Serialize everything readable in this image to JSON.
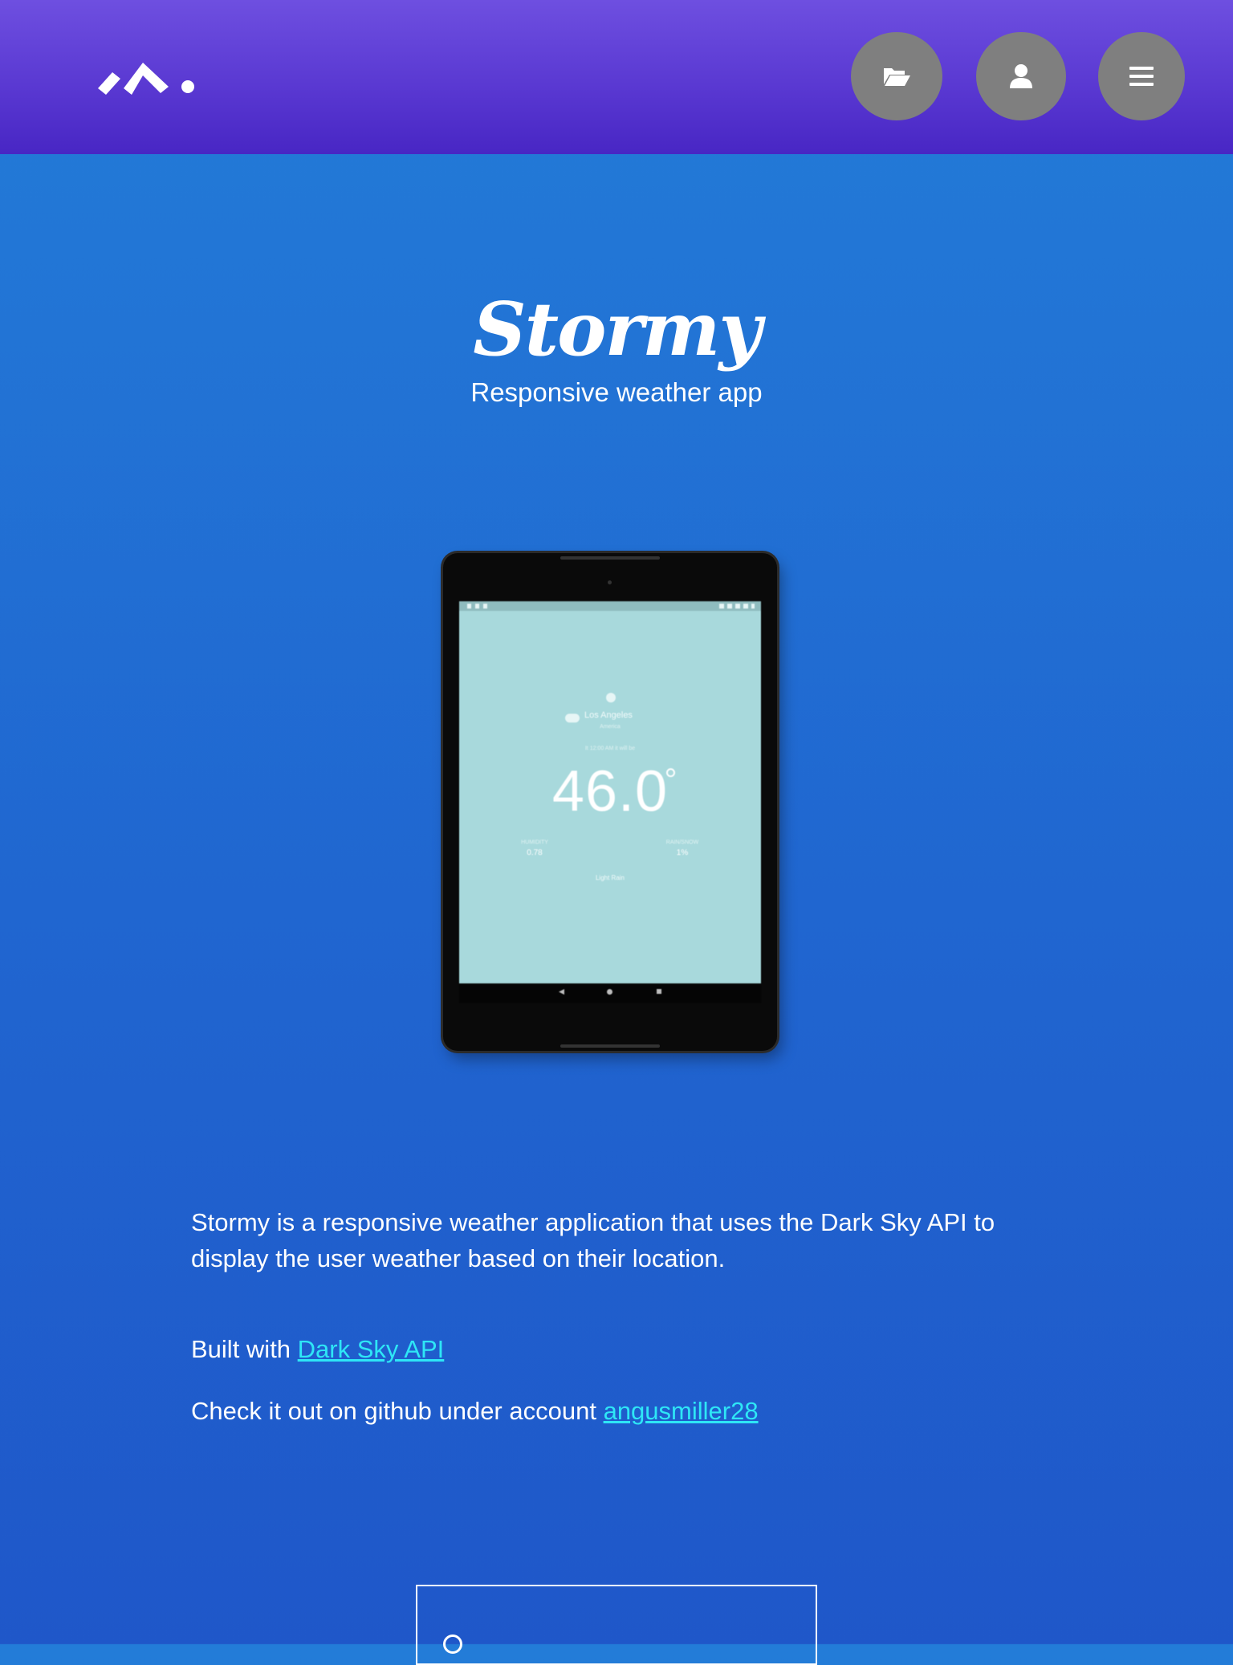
{
  "header": {
    "logo_icon": "brand-logo-icon",
    "buttons": [
      {
        "icon": "folder-open-icon",
        "label": "Projects"
      },
      {
        "icon": "user-icon",
        "label": "Profile"
      },
      {
        "icon": "menu-icon",
        "label": "Menu"
      }
    ],
    "colors": {
      "header_top": "#6e4fe0",
      "header_bottom": "#4826c4",
      "button_bg": "#7f7f7f"
    }
  },
  "hero": {
    "title": "Stormy",
    "subtitle": "Responsive weather app"
  },
  "device_screen": {
    "city": "Los Angeles",
    "region": "America",
    "time": "It 12:00 AM it will be",
    "temperature": "46.0",
    "humidity_label": "HUMIDITY",
    "humidity_value": "0.78",
    "precip_label": "RAIN/SNOW",
    "precip_value": "1%",
    "summary": "Light Rain",
    "bg_color": "#a8d9dc"
  },
  "content": {
    "description": "Stormy is a responsive weather application that uses the Dark Sky API to display the user weather based on their location.",
    "built_with_prefix": "Built with",
    "built_with_link": "Dark Sky API",
    "github_prefix": "Check it out on github under account",
    "github_link": "angusmiller28",
    "link_color": "#2ee6f6"
  },
  "page": {
    "bg_top": "#237cd8",
    "bg_bottom": "#1f57c9"
  }
}
